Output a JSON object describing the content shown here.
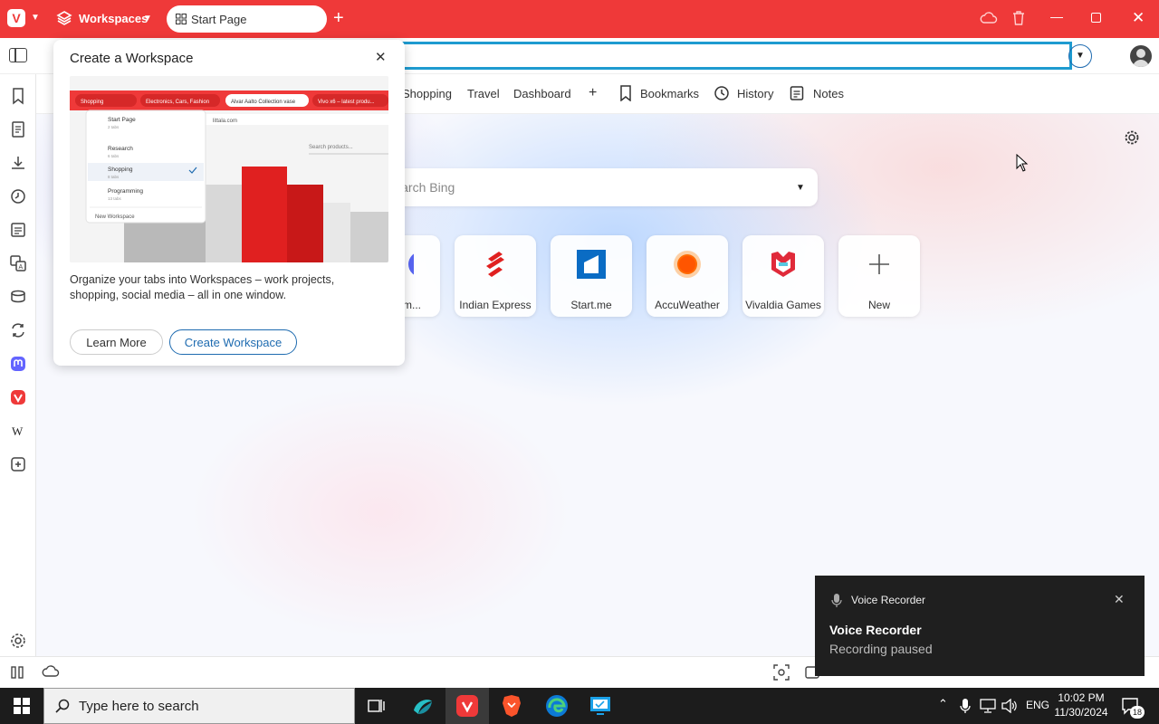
{
  "titlebar": {
    "workspaces_label": "Workspaces",
    "tab_title": "Start Page",
    "accent": "#ef3939"
  },
  "bookmarks": {
    "items": [
      "Shopping",
      "Travel",
      "Dashboard"
    ],
    "add": "+",
    "bookmarks_label": "Bookmarks",
    "history_label": "History",
    "notes_label": "Notes"
  },
  "search": {
    "placeholder": "Search Bing"
  },
  "speed_dials": [
    {
      "title": "Decom...",
      "icon": "discord-icon"
    },
    {
      "title": "Indian Express",
      "icon": "indian-express-icon"
    },
    {
      "title": "Start.me",
      "icon": "startme-icon"
    },
    {
      "title": "AccuWeather",
      "icon": "accuweather-icon"
    },
    {
      "title": "Vivaldia Games",
      "icon": "vivaldia-icon"
    },
    {
      "title": "New",
      "icon": "plus-icon"
    }
  ],
  "popup": {
    "title": "Create a Workspace",
    "description": "Organize your tabs into Workspaces – work projects, shopping, social media – all in one window.",
    "learn_more": "Learn More",
    "create": "Create Workspace",
    "preview": {
      "tabs": [
        "Shopping",
        "Electronics, Cars, Fashion",
        "Alvar Aalto Collection vase",
        "Vivo x6 – latest produ..."
      ],
      "url": "littala.com",
      "search": "Search products...",
      "menu": [
        {
          "name": "Start Page",
          "count": "2 tabs"
        },
        {
          "name": "Research",
          "count": "6 tabs"
        },
        {
          "name": "Shopping",
          "count": "8 tabs"
        },
        {
          "name": "Programming",
          "count": "13 tabs"
        }
      ],
      "new_workspace": "New Workspace"
    }
  },
  "toast": {
    "app": "Voice Recorder",
    "title": "Voice Recorder",
    "body": "Recording paused"
  },
  "taskbar": {
    "search_placeholder": "Type here to search",
    "lang": "ENG",
    "time": "10:02 PM",
    "date": "11/30/2024",
    "notifications": "18"
  }
}
